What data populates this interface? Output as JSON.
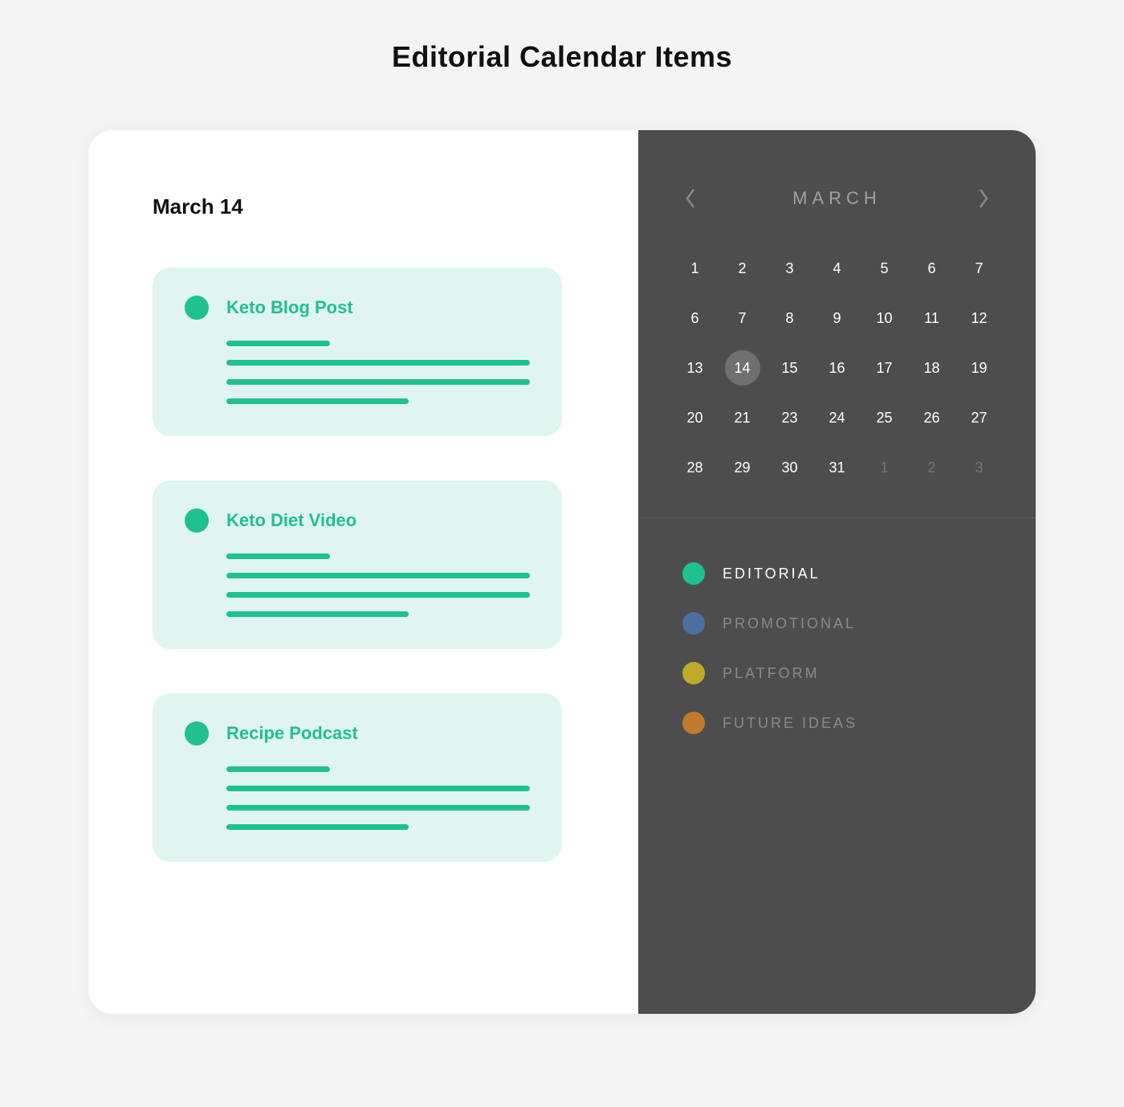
{
  "page_title": "Editorial Calendar Items",
  "date_heading": "March 14",
  "items": [
    {
      "title": "Keto Blog Post",
      "category": "editorial"
    },
    {
      "title": "Keto Diet Video",
      "category": "editorial"
    },
    {
      "title": "Recipe Podcast",
      "category": "editorial"
    }
  ],
  "calendar": {
    "month_label": "MARCH",
    "selected_day": 14,
    "days": [
      {
        "num": 1,
        "muted": false
      },
      {
        "num": 2,
        "muted": false
      },
      {
        "num": 3,
        "muted": false
      },
      {
        "num": 4,
        "muted": false
      },
      {
        "num": 5,
        "muted": false
      },
      {
        "num": 6,
        "muted": false
      },
      {
        "num": 7,
        "muted": false
      },
      {
        "num": 6,
        "muted": false
      },
      {
        "num": 7,
        "muted": false
      },
      {
        "num": 8,
        "muted": false
      },
      {
        "num": 9,
        "muted": false
      },
      {
        "num": 10,
        "muted": false
      },
      {
        "num": 11,
        "muted": false
      },
      {
        "num": 12,
        "muted": false
      },
      {
        "num": 13,
        "muted": false
      },
      {
        "num": 14,
        "muted": false
      },
      {
        "num": 15,
        "muted": false
      },
      {
        "num": 16,
        "muted": false
      },
      {
        "num": 17,
        "muted": false
      },
      {
        "num": 18,
        "muted": false
      },
      {
        "num": 19,
        "muted": false
      },
      {
        "num": 20,
        "muted": false
      },
      {
        "num": 21,
        "muted": false
      },
      {
        "num": 23,
        "muted": false
      },
      {
        "num": 24,
        "muted": false
      },
      {
        "num": 25,
        "muted": false
      },
      {
        "num": 26,
        "muted": false
      },
      {
        "num": 27,
        "muted": false
      },
      {
        "num": 28,
        "muted": false
      },
      {
        "num": 29,
        "muted": false
      },
      {
        "num": 30,
        "muted": false
      },
      {
        "num": 31,
        "muted": false
      },
      {
        "num": 1,
        "muted": true
      },
      {
        "num": 2,
        "muted": true
      },
      {
        "num": 3,
        "muted": true
      }
    ]
  },
  "legend": [
    {
      "label": "EDITORIAL",
      "color": "#1fc18f",
      "active": true
    },
    {
      "label": "PROMOTIONAL",
      "color": "#4b6fa0",
      "active": false
    },
    {
      "label": "PLATFORM",
      "color": "#c0a82b",
      "active": false
    },
    {
      "label": "FUTURE IDEAS",
      "color": "#c07a2b",
      "active": false
    }
  ],
  "colors": {
    "accent": "#1fc18f",
    "item_bg": "#e0f5ef",
    "panel_dark": "#4e4d4d"
  }
}
